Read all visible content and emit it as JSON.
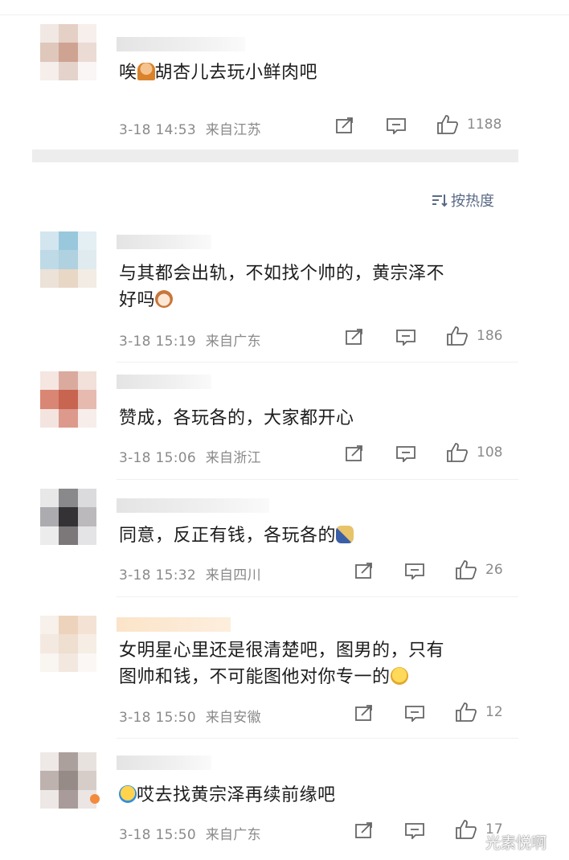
{
  "comments": [
    {
      "text": "唉",
      "emoji_after_first": "person-facepalm-emoji",
      "text2": "胡杏儿去玩小鲜肉吧",
      "time": "3-18 14:53",
      "location": "来自江苏",
      "likes": "1188"
    },
    {
      "text": "与其都会出轨，不如找个帅的，黄宗泽不",
      "text_line2": "好吗",
      "emoji": "dog-face-emoji",
      "time": "3-18 15:19",
      "location": "来自广东",
      "likes": "186"
    },
    {
      "text": "赞成，各玩各的，大家都开心",
      "time": "3-18 15:06",
      "location": "来自浙江",
      "likes": "108"
    },
    {
      "text": "同意，反正有钱，各玩各的",
      "emoji": "microphone-emoji",
      "time": "3-18 15:32",
      "location": "来自四川",
      "likes": "26"
    },
    {
      "text": "女明星心里还是很清楚吧，图男的，只有",
      "text_line2": "图帅和钱，不可能图他对你专一的",
      "emoji": "thinking-face-emoji",
      "time": "3-18 15:50",
      "location": "来自安徽",
      "likes": "12"
    },
    {
      "text": "哎去找黄宗泽再续前缘吧",
      "emoji_before": "laughing-crying-emoji",
      "time": "3-18 15:50",
      "location": "来自广东",
      "likes": "17"
    }
  ],
  "sort_label": "按热度",
  "watermark": "光素悦啊"
}
